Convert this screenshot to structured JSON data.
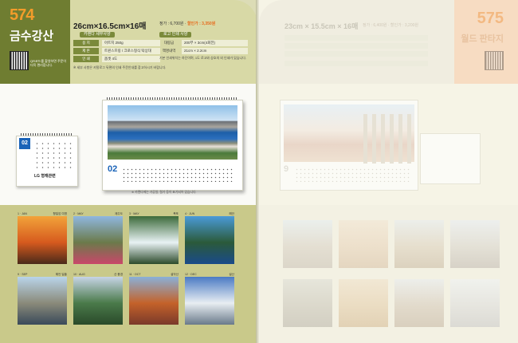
{
  "left_page": {
    "product_code": "574",
    "product_title": "금수강산",
    "qr_note": "QR코드를 촬영하면 주문이 더욱 편리합니다.",
    "size": "26cm×16.5cm×16매",
    "price_label": "정가 : 6,700원 ·",
    "price_sale": "할인가 : 3,350원",
    "spec_pill": "카렌다 세부사양",
    "option_pill": "로고 인쇄 사양",
    "specs": [
      {
        "k": "용  지",
        "v": "아트지 250g"
      },
      {
        "k": "제  본",
        "v": "트윈스프링 / 크로스형식 탁상대"
      },
      {
        "k": "인  쇄",
        "v": "옵셋 4도"
      }
    ],
    "options": [
      {
        "k": "대량금",
        "v": "200부 × 3cm(4회전)"
      },
      {
        "k": "책명내역",
        "v": "21cm × 2.2cm"
      }
    ],
    "option_note": "기본 인쇄위치는 하단이며, 1도 로고와 상호의 외 인쇄가 있습니다.",
    "foot_note": "※ 세부 사항은 카탈로그 뒤편의 인쇄 주문안내를 참고하시기 바랍니다.",
    "small_cal_month": "02",
    "small_cal_logo": "LG 형재관련",
    "large_cal_month": "02",
    "caption": "※ 카렌다에는 가공일, 절기 등이 표기되어 있습니다.",
    "thumbnails": [
      {
        "month": "1 · JAN",
        "place": "향일암 여명",
        "colors": [
          "#f2a33a",
          "#d65a1e",
          "#4a2a1a"
        ]
      },
      {
        "month": "2 · MAY",
        "place": "제주도",
        "colors": [
          "#8fb7e0",
          "#6b7a4a",
          "#c9476a"
        ]
      },
      {
        "month": "3 · MAY",
        "place": "폭포",
        "colors": [
          "#3c6a3a",
          "#e8f2f4",
          "#2b4a2a"
        ]
      },
      {
        "month": "4 · JUN",
        "place": "해안",
        "colors": [
          "#4a9ad8",
          "#2b5a3a",
          "#1a4a8a"
        ]
      },
      {
        "month": "9 · SEP",
        "place": "해안 일출",
        "colors": [
          "#b9d4ea",
          "#8a8a7a",
          "#3a4a5a"
        ]
      },
      {
        "month": "10 · AUG",
        "place": "산 풍경",
        "colors": [
          "#c7d4e6",
          "#4a7a4a",
          "#2a4a2a"
        ]
      },
      {
        "month": "11 · OCT",
        "place": "설악산",
        "colors": [
          "#8ab0d8",
          "#c4622a",
          "#7a3a2a"
        ]
      },
      {
        "month": "12 · DEC",
        "place": "설산",
        "colors": [
          "#4a7ac4",
          "#e8eef2",
          "#6a7a8a"
        ]
      }
    ]
  },
  "right_page": {
    "product_code": "575",
    "product_title": "월드 판타지",
    "size": "23cm × 15.5cm × 16매",
    "price": "정가 : 6,400원 · 할인가 : 3,200원",
    "large_cal_month": "9"
  },
  "colors": {
    "accent_orange": "#f39c2a",
    "olive": "#6f7d31",
    "calendar_blue": "#1a63b8"
  }
}
